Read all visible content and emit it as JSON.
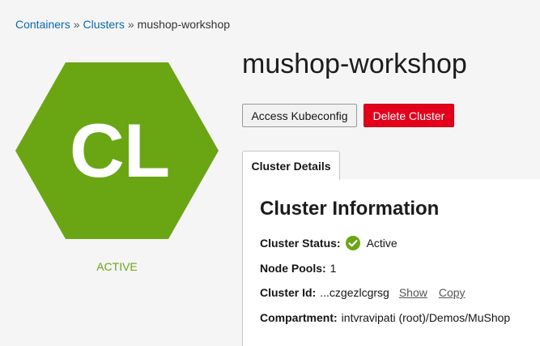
{
  "breadcrumb": {
    "items": [
      "Containers",
      "Clusters"
    ],
    "separator": "»",
    "current": "mushop-workshop"
  },
  "avatar": {
    "initials": "CL",
    "status": "ACTIVE",
    "color": "#6aa614"
  },
  "header": {
    "title": "mushop-workshop"
  },
  "actions": {
    "access_kubeconfig": "Access Kubeconfig",
    "delete_cluster": "Delete Cluster"
  },
  "tabs": {
    "active": "Cluster Details"
  },
  "cluster_info": {
    "heading": "Cluster Information",
    "status_label": "Cluster Status:",
    "status_value": "Active",
    "node_pools_label": "Node Pools:",
    "node_pools_value": "1",
    "cluster_id_label": "Cluster Id:",
    "cluster_id_value": "...czgezlcgrsg",
    "show_link": "Show",
    "copy_link": "Copy",
    "compartment_label": "Compartment:",
    "compartment_value": "intvravipati (root)/Demos/MuShop"
  }
}
